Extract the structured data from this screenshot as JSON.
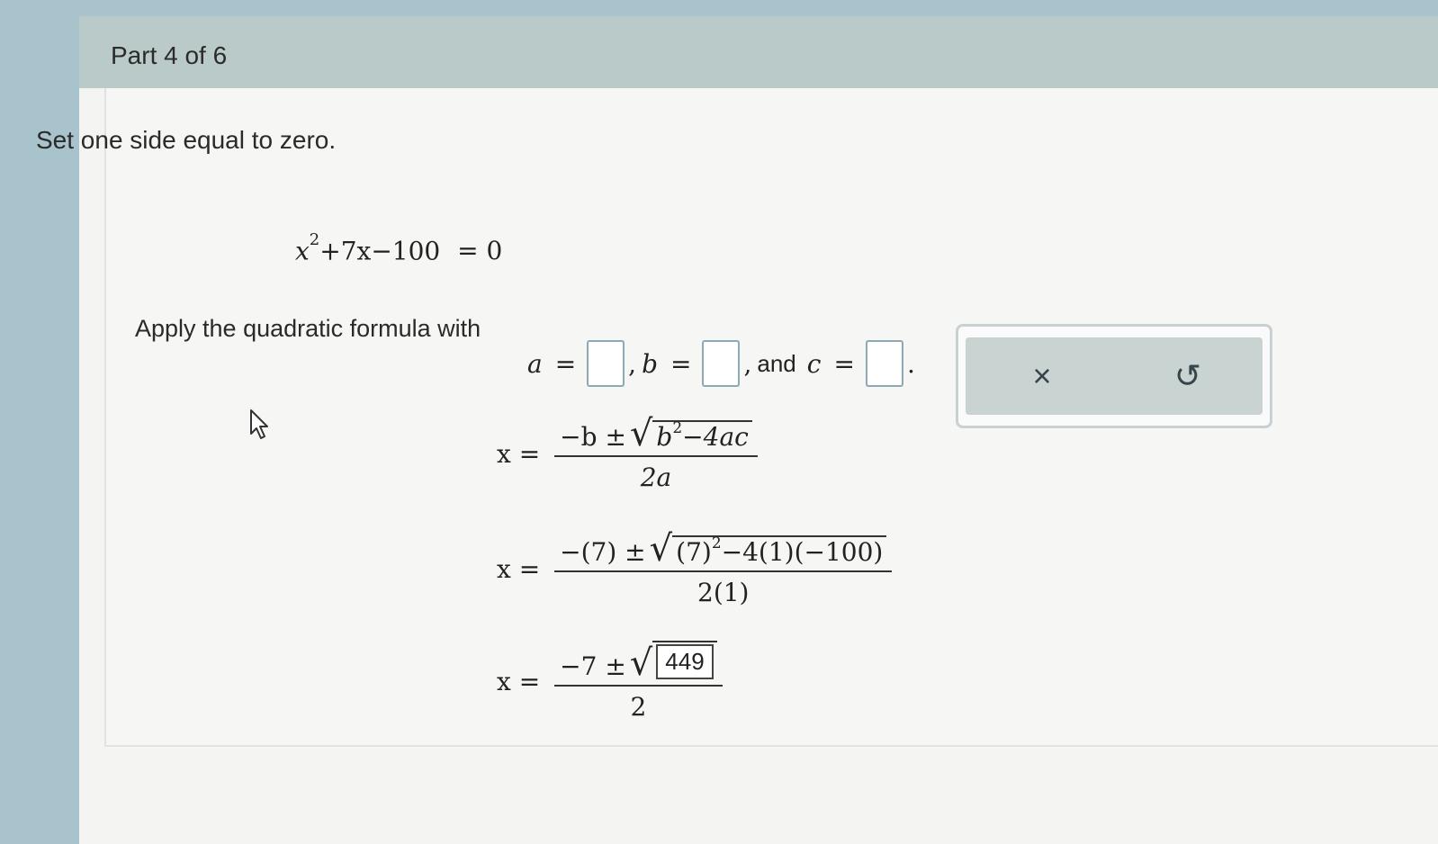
{
  "header": {
    "part_label": "Part 4 of 6"
  },
  "instruction": "Set one side equal to zero.",
  "equation": {
    "lhs_base": "x",
    "lhs_exp": "2",
    "rest": "+7x−100",
    "eq": "= 0"
  },
  "apply": {
    "text": "Apply the quadratic formula with",
    "a_label": "a",
    "b_label": "b",
    "c_label": "c",
    "equals": "=",
    "comma": ",",
    "and": "and",
    "period": ".",
    "a_value": "",
    "b_value": "",
    "c_value": ""
  },
  "toolbox": {
    "clear_icon": "×",
    "undo_icon": "↺"
  },
  "formula1": {
    "lhs": "x =",
    "numer_prefix": "−b ±",
    "radicand_base": "b",
    "radicand_exp": "2",
    "radicand_rest": "−4ac",
    "denom": "2a"
  },
  "formula2": {
    "lhs": "x =",
    "numer_prefix": "−(7) ±",
    "radicand_base": "(7)",
    "radicand_exp": "2",
    "radicand_rest": "−4(1)(−100)",
    "denom": "2(1)"
  },
  "formula3": {
    "lhs": "x =",
    "numer_prefix": "−7 ±",
    "radicand_value": "449",
    "denom": "2"
  }
}
